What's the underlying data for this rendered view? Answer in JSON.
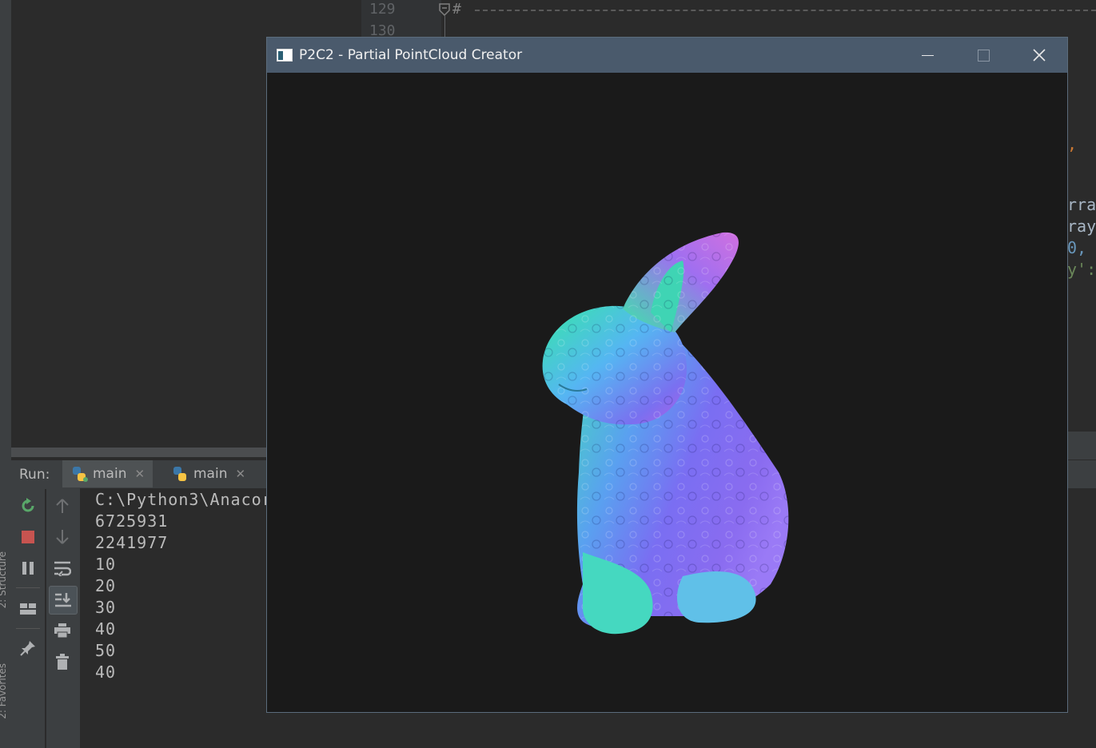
{
  "editor": {
    "line_numbers": [
      "129",
      "130"
    ],
    "comment_line": "#",
    "right_fragments": [
      ",",
      "rra",
      "ray",
      "0,",
      "y':"
    ],
    "colors": {
      "comment": "#808080",
      "orange": "#cc7832",
      "text": "#a9b7c6",
      "number": "#6897bb",
      "string": "#6a8759"
    }
  },
  "run_panel": {
    "label": "Run:",
    "tabs": [
      {
        "label": "main",
        "icon": "python-icon"
      },
      {
        "label": "main",
        "icon": "python-icon"
      }
    ],
    "toolbar": [
      "rerun-icon",
      "stop-icon",
      "pause-icon",
      "layout-icon",
      "pin-icon"
    ],
    "toolbar2": [
      "up-arrow-icon",
      "down-arrow-icon",
      "soft-wrap-icon",
      "scroll-to-end-icon",
      "print-icon",
      "trash-icon"
    ],
    "console_lines": [
      "C:\\Python3\\Anacor",
      "6725931",
      "2241977",
      "10",
      "20",
      "30",
      "40",
      "50",
      "40"
    ]
  },
  "side_tabs": {
    "structure": "2: Structure",
    "favorites": "2: Favorites"
  },
  "app_window": {
    "title": "P2C2 - Partial PointCloud Creator",
    "controls": [
      "minimize-icon",
      "maximize-icon",
      "close-icon"
    ],
    "viewport_content": "normal-shaded-bunny-model"
  }
}
